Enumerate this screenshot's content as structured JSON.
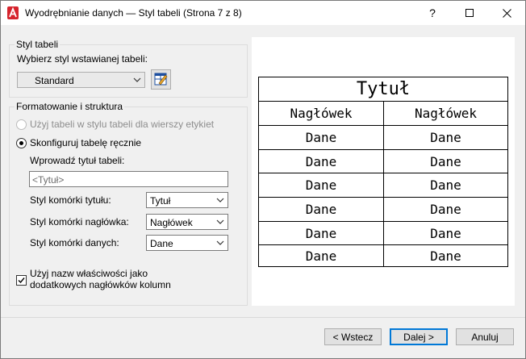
{
  "window": {
    "title": "Wyodrębnianie danych — Styl tabeli (Strona 7 z 8)",
    "help_glyph": "?",
    "maximize_glyph": "☐",
    "close_glyph": "✕"
  },
  "table_style_group": {
    "label": "Styl tabeli",
    "select_label": "Wybierz styl wstawianej tabeli:",
    "selected_style": "Standard"
  },
  "format_group": {
    "label": "Formatowanie i struktura",
    "radio_use_style": "Użyj tabeli w stylu tabeli dla wierszy etykiet",
    "radio_manual": "Skonfiguruj tabelę ręcznie",
    "title_prompt": "Wprowadź tytuł tabeli:",
    "title_placeholder": "<Tytuł>",
    "title_cell_label": "Styl komórki tytułu:",
    "title_cell_value": "Tytuł",
    "header_cell_label": "Styl komórki nagłówka:",
    "header_cell_value": "Nagłówek",
    "data_cell_label": "Styl komórki danych:",
    "data_cell_value": "Dane",
    "checkbox_label_line1": "Użyj nazw właściwości jako",
    "checkbox_label_line2": "dodatkowych nagłówków kolumn",
    "checkbox_checked": true
  },
  "preview": {
    "title": "Tytuł",
    "headers": [
      "Nagłówek",
      "Nagłówek"
    ],
    "rows": [
      [
        "Dane",
        "Dane"
      ],
      [
        "Dane",
        "Dane"
      ],
      [
        "Dane",
        "Dane"
      ],
      [
        "Dane",
        "Dane"
      ],
      [
        "Dane",
        "Dane"
      ],
      [
        "Dane",
        "Dane"
      ]
    ]
  },
  "buttons": {
    "back": "< Wstecz",
    "next": "Dalej >",
    "cancel": "Anuluj"
  },
  "colors": {
    "accent": "#0078d7",
    "app_icon": "#d6242d"
  }
}
